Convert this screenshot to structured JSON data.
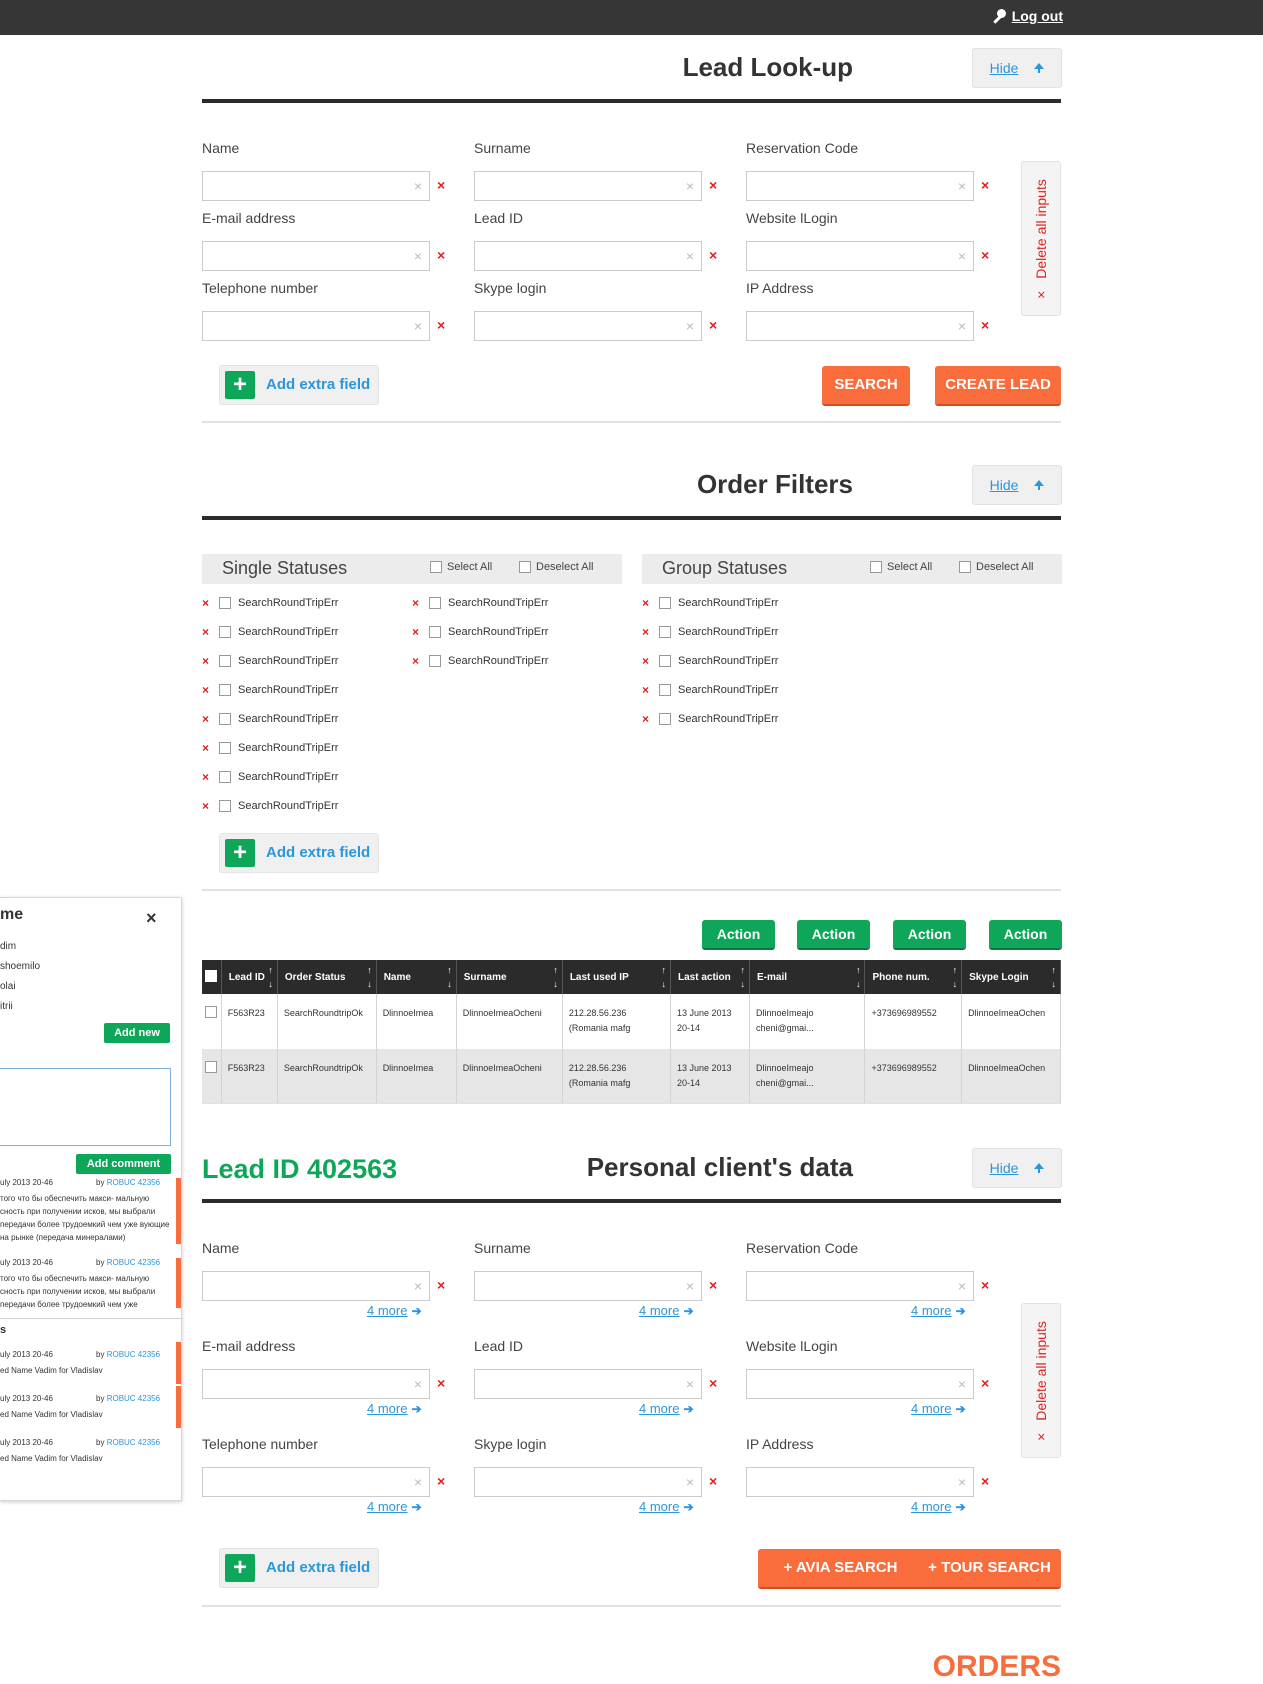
{
  "topbar": {
    "logout": "Log out",
    "icon": "key-icon"
  },
  "lookup": {
    "title": "Lead Look-up",
    "hide": "Hide",
    "fields": [
      "Name",
      "Surname",
      "Reservation Code",
      "E-mail address",
      "Lead ID",
      "Website lLogin",
      "Telephone number",
      "Skype login",
      "IP Address"
    ],
    "clear_glyph": "×",
    "remove_glyph": "×",
    "add_extra": "Add extra field",
    "search": "SEARCH",
    "create": "CREATE LEAD",
    "delete_all": "Delete all inputs"
  },
  "filters": {
    "title": "Order Filters",
    "hide": "Hide",
    "single": {
      "title": "Single Statuses",
      "select_all": "Select All",
      "deselect_all": "Deselect All"
    },
    "group": {
      "title": "Group Statuses",
      "select_all": "Select All",
      "deselect_all": "Deselect All"
    },
    "item": "SearchRoundTripErr",
    "add_extra": "Add extra field"
  },
  "actions": [
    "Action",
    "Action",
    "Action",
    "Action"
  ],
  "table": {
    "columns": [
      "Lead ID",
      "Order Status",
      "Name",
      "Surname",
      "Last used IP",
      "Last action",
      "E-mail",
      "Phone num.",
      "Skype Login"
    ],
    "rows": [
      [
        "F563R23",
        "SearchRoundtripOk",
        "DlinnoeImea",
        "DlinnoeImeaOcheni",
        "212.28.56.236 (Romania mafg",
        "13 June 2013 20-14",
        "DlinnoeImeajo cheni@gmai...",
        "+373696989552",
        "DlinnoeImeaOchen"
      ],
      [
        "F563R23",
        "SearchRoundtripOk",
        "DlinnoeImea",
        "DlinnoeImeaOcheni",
        "212.28.56.236 (Romania mafg",
        "13 June 2013 20-14",
        "DlinnoeImeajo cheni@gmai...",
        "+373696989552",
        "DlinnoeImeaOchen"
      ]
    ]
  },
  "client": {
    "lead_id": "Lead ID 402563",
    "title": "Personal client's data",
    "hide": "Hide",
    "more": "4 more",
    "add_extra": "Add extra field",
    "avia": "+ AVIA SEARCH",
    "tour": "+ TOUR SEARCH",
    "delete_all": "Delete all inputs"
  },
  "orders": "ORDERS",
  "panel": {
    "header": "me",
    "close": "×",
    "names": [
      "dim",
      "shoemilo",
      "olai",
      "itrii"
    ],
    "add_new": "Add new",
    "add_comment": "Add comment",
    "comments": [
      {
        "date": "uly 2013 20-46",
        "by": "by",
        "user": "ROBUC 42356",
        "text": "того что бы обеспечить макси- мальную сность при получении исков, мы выбрали передачи более трудоемкий чем уже вующие на рынке (передача минералами)"
      },
      {
        "date": "uly 2013 20-46",
        "by": "by",
        "user": "ROBUC 42356",
        "text": "того что бы обеспечить макси- мальную сность при получении исков, мы выбрали передачи более трудоемкий чем уже"
      }
    ],
    "section2": "s",
    "notes": [
      {
        "date": "uly 2013 20-46",
        "by": "by",
        "user": "ROBUC 42356",
        "text": "ed Name Vadim for Vladislav"
      },
      {
        "date": "uly 2013 20-46",
        "by": "by",
        "user": "ROBUC 42356",
        "text": "ed Name Vadim for Vladislav"
      },
      {
        "date": "uly 2013 20-46",
        "by": "by",
        "user": "ROBUC 42356",
        "text": "ed Name Vadim for Vladislav"
      }
    ]
  }
}
